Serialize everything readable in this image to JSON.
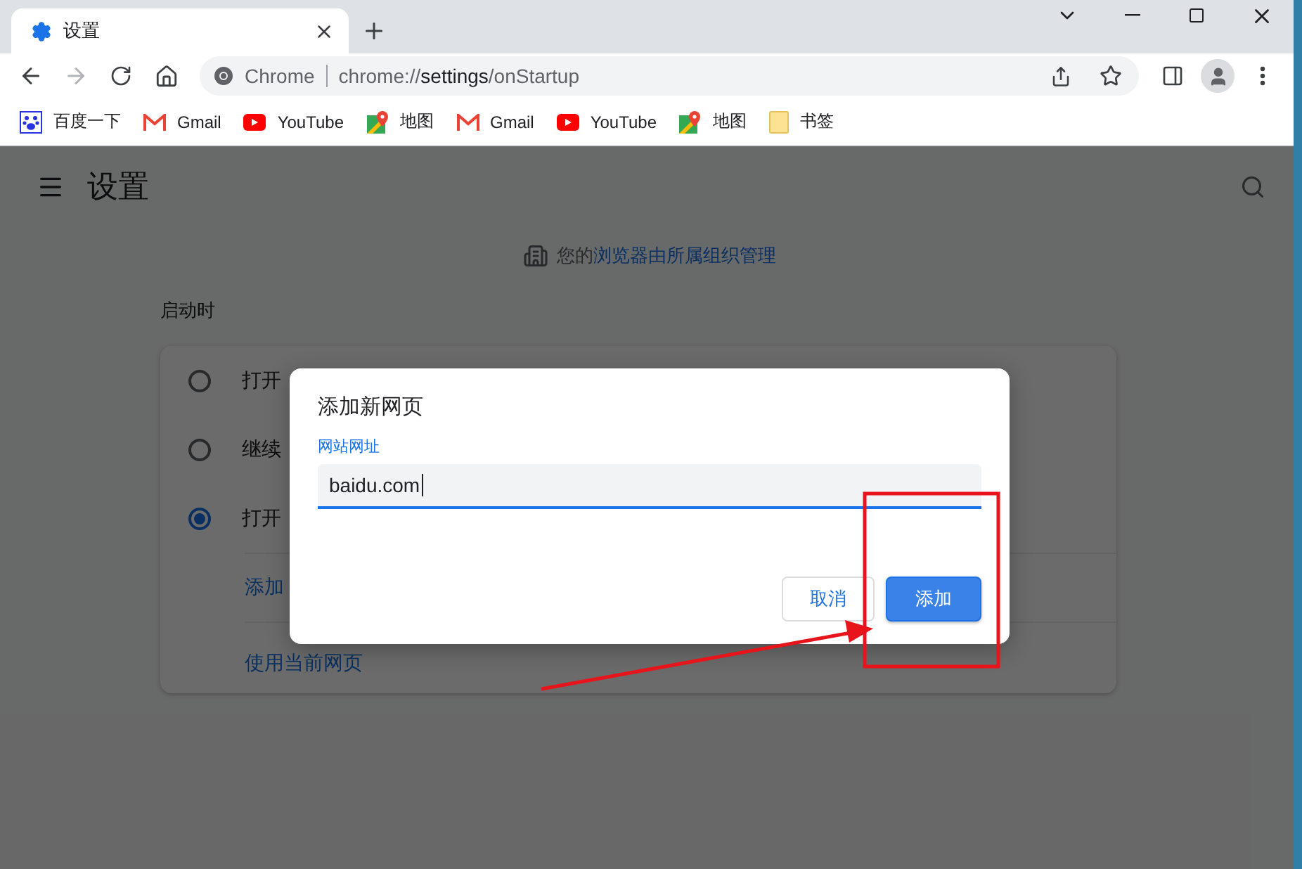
{
  "tabs": [
    {
      "label": "设置",
      "selected": true
    }
  ],
  "toolbar": {
    "site_label": "Chrome",
    "url_scheme": "chrome://",
    "url_host": "settings",
    "url_path": "/onStartup"
  },
  "bookmarks": [
    {
      "label": "百度一下",
      "kind": "baidu"
    },
    {
      "label": "Gmail",
      "kind": "gmail"
    },
    {
      "label": "YouTube",
      "kind": "youtube"
    },
    {
      "label": "地图",
      "kind": "maps"
    },
    {
      "label": "Gmail",
      "kind": "gmail"
    },
    {
      "label": "YouTube",
      "kind": "youtube"
    },
    {
      "label": "地图",
      "kind": "maps"
    },
    {
      "label": "书签",
      "kind": "folder"
    }
  ],
  "settings": {
    "title": "设置",
    "notice_prefix": "您的",
    "notice_link": "浏览器由所属组织管理",
    "section_title": "启动时",
    "options": [
      {
        "label": "打开",
        "selected": false
      },
      {
        "label": "继续",
        "selected": false
      },
      {
        "label": "打开",
        "selected": true
      }
    ],
    "links": [
      "添加",
      "使用当前网页"
    ]
  },
  "dialog": {
    "title": "添加新网页",
    "field_label": "网站网址",
    "value": "baidu.com",
    "buttons": [
      {
        "label": "取消",
        "kind": "secondary"
      },
      {
        "label": "添加",
        "kind": "primary"
      }
    ]
  }
}
